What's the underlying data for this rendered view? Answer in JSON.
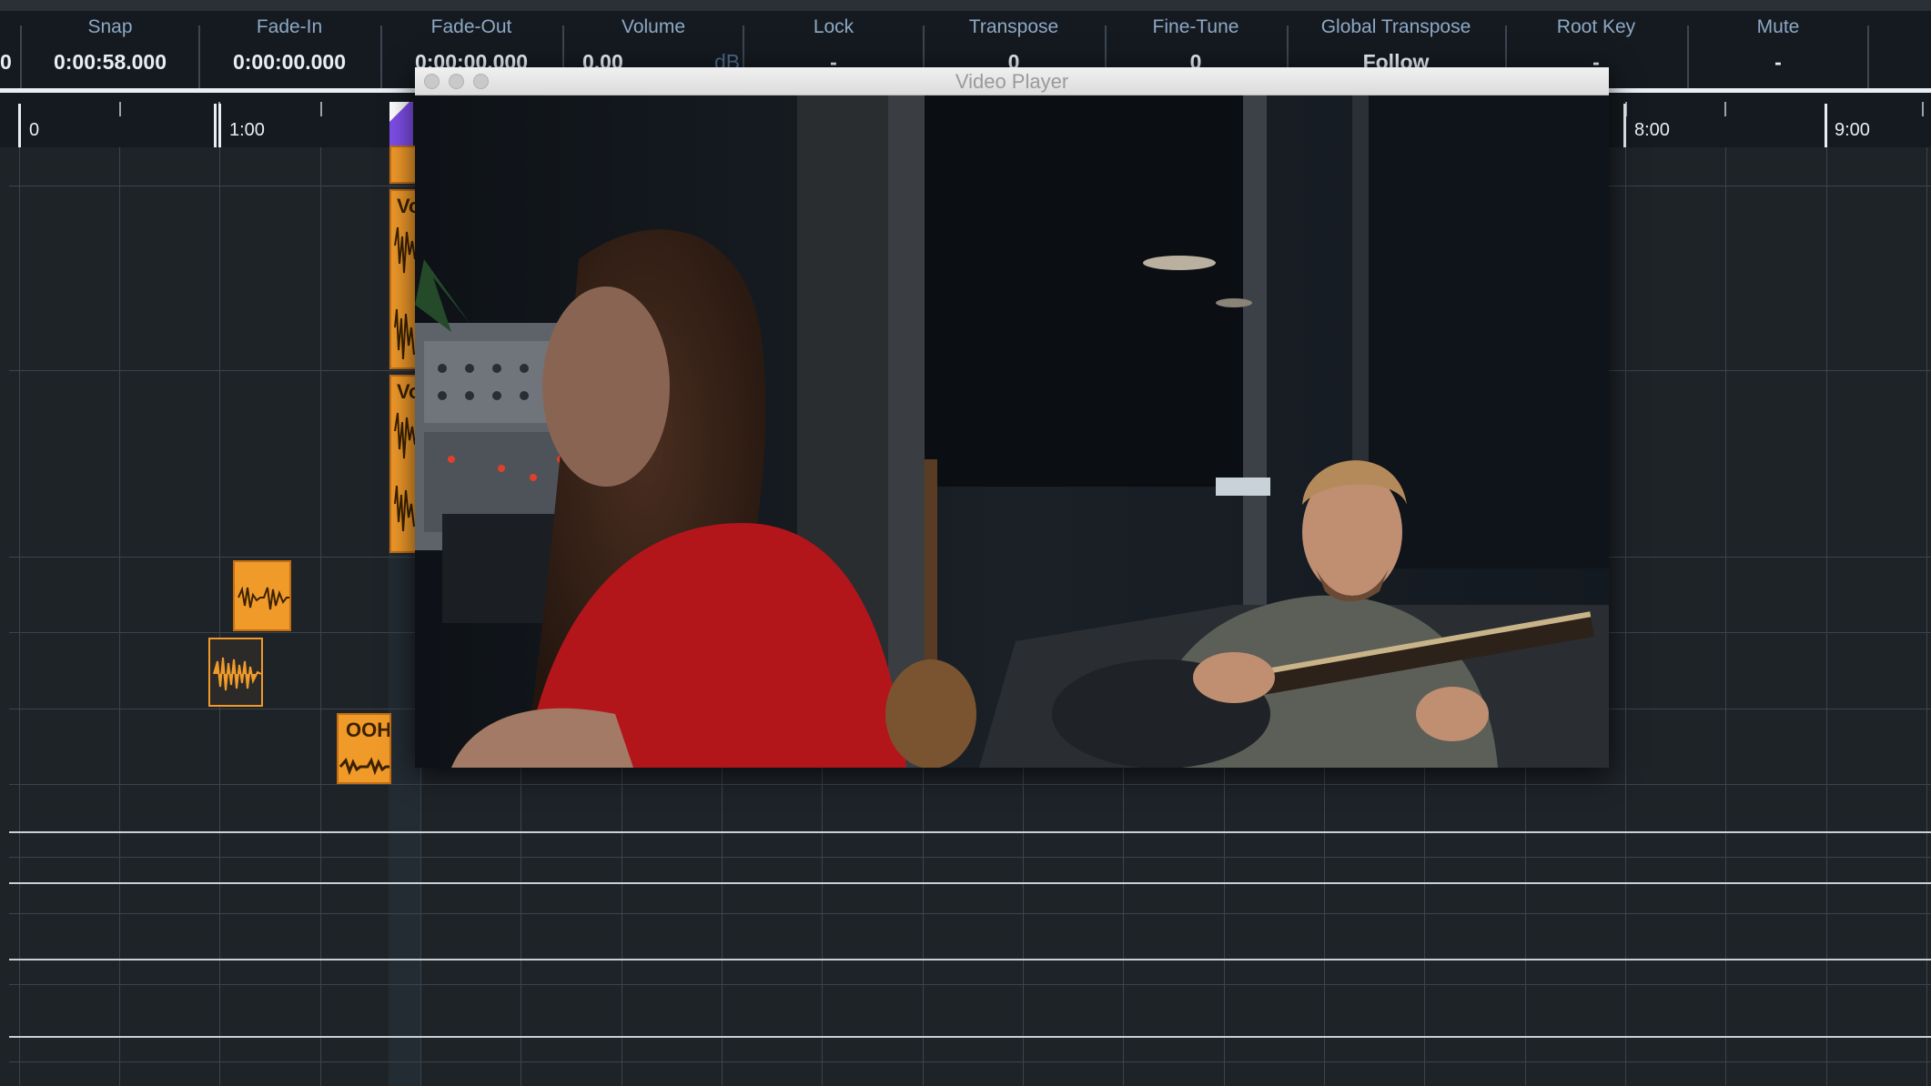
{
  "infoline": {
    "left_edge_value": "0",
    "fields": [
      {
        "label": "Snap",
        "value": "0:00:58.000"
      },
      {
        "label": "Fade-In",
        "value": "0:00:00.000"
      },
      {
        "label": "Fade-Out",
        "value": "0:00:00.000"
      },
      {
        "label": "Volume",
        "value": "0.00",
        "unit": "dB"
      },
      {
        "label": "Lock",
        "value": "-"
      },
      {
        "label": "Transpose",
        "value": "0"
      },
      {
        "label": "Fine-Tune",
        "value": "0"
      },
      {
        "label": "Global Transpose",
        "value": "Follow"
      },
      {
        "label": "Root Key",
        "value": "-"
      },
      {
        "label": "Mute",
        "value": "-"
      }
    ]
  },
  "ruler": {
    "labels": [
      "0",
      "1:00",
      "8:00",
      "9:00"
    ]
  },
  "events": [
    {
      "name": "Vo"
    },
    {
      "name": "Vo"
    },
    {
      "name": "OOH"
    }
  ],
  "video_player": {
    "title": "Video Player"
  },
  "colors": {
    "accent_event": "#f09a2a",
    "playhead": "#7e4ee8",
    "label": "#8ea8c4"
  }
}
